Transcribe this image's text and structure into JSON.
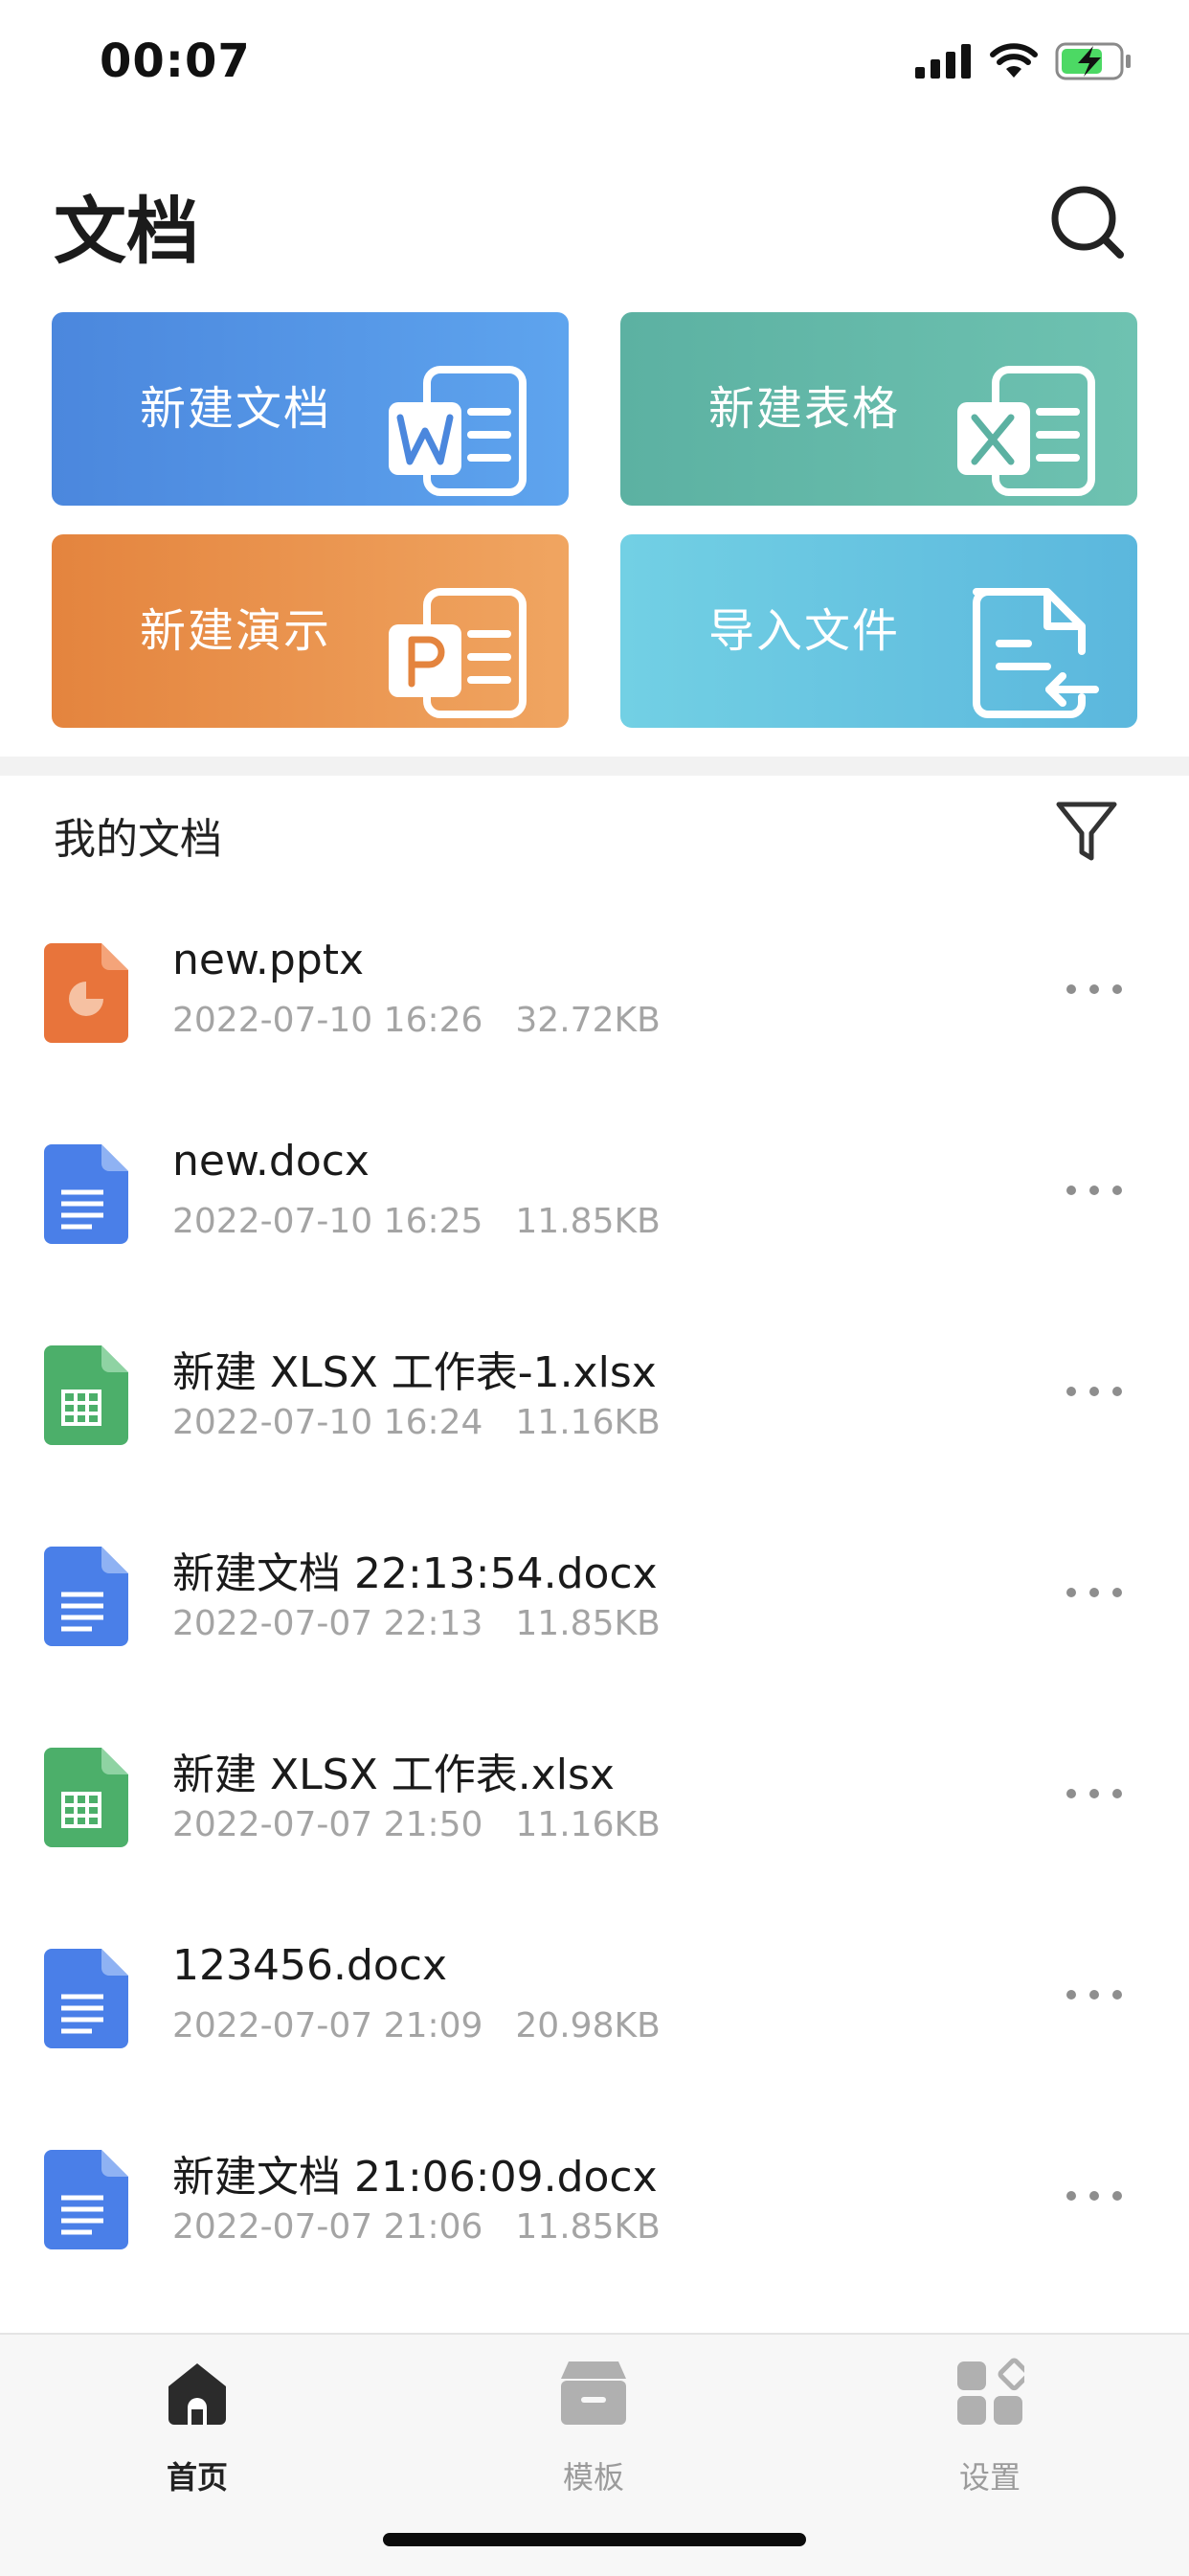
{
  "status_bar": {
    "time": "00:07"
  },
  "header": {
    "title": "文档"
  },
  "quick_actions": {
    "new_document": "新建文档",
    "new_spreadsheet": "新建表格",
    "new_presentation": "新建演示",
    "import_file": "导入文件"
  },
  "section": {
    "title": "我的文档"
  },
  "files": [
    {
      "name": "new.pptx",
      "date": "2022-07-10 16:26",
      "size": "32.72KB",
      "type": "pptx"
    },
    {
      "name": "new.docx",
      "date": "2022-07-10 16:25",
      "size": "11.85KB",
      "type": "docx"
    },
    {
      "name": "新建 XLSX 工作表-1.xlsx",
      "date": "2022-07-10 16:24",
      "size": "11.16KB",
      "type": "xlsx"
    },
    {
      "name": "新建文档 22:13:54.docx",
      "date": "2022-07-07 22:13",
      "size": "11.85KB",
      "type": "docx"
    },
    {
      "name": "新建 XLSX 工作表.xlsx",
      "date": "2022-07-07 21:50",
      "size": "11.16KB",
      "type": "xlsx"
    },
    {
      "name": "123456.docx",
      "date": "2022-07-07 21:09",
      "size": "20.98KB",
      "type": "docx"
    },
    {
      "name": "新建文档 21:06:09.docx",
      "date": "2022-07-07 21:06",
      "size": "11.85KB",
      "type": "docx"
    }
  ],
  "tabs": [
    {
      "label": "首页",
      "icon": "home-icon",
      "active": true
    },
    {
      "label": "模板",
      "icon": "template-box-icon",
      "active": false
    },
    {
      "label": "设置",
      "icon": "settings-grid-icon",
      "active": false
    }
  ],
  "colors": {
    "word_card": "#4b87dd",
    "excel_card": "#5cb1a2",
    "ppt_card": "#e4843e",
    "import_card": "#5bb7dd",
    "pptx_icon": "#e8743b",
    "docx_icon": "#4a7fe8",
    "xlsx_icon": "#4caf6a",
    "meta_text": "#a4a4a4"
  }
}
